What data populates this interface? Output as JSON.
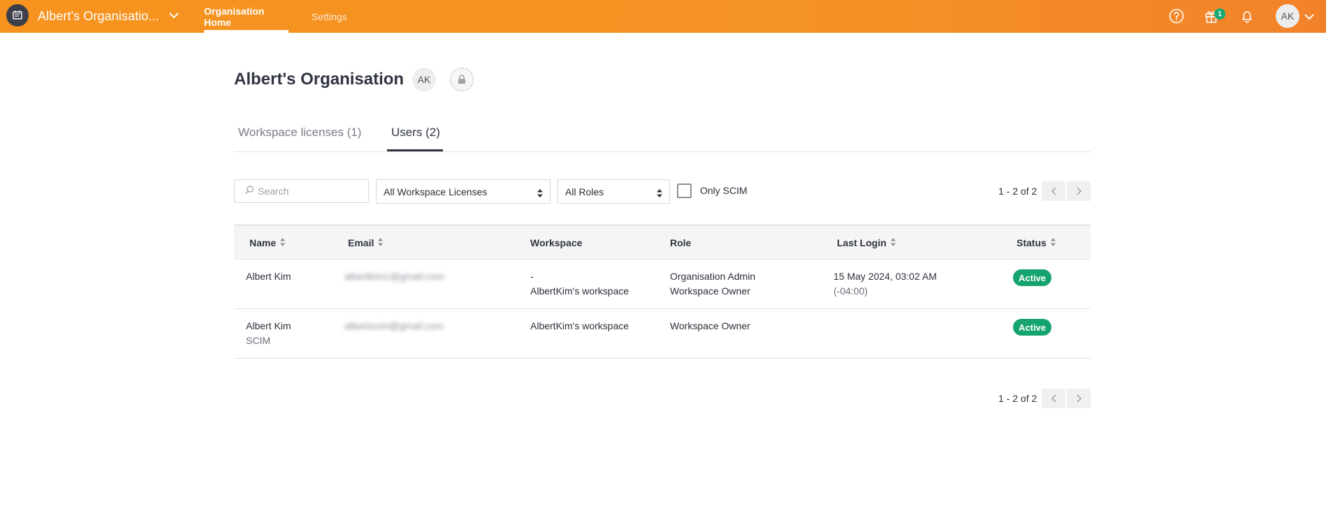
{
  "topbar": {
    "org_name": "Albert's Organisatio...",
    "nav": {
      "home": "Organisation Home",
      "settings": "Settings"
    },
    "gift_badge_count": "1",
    "user_initials": "AK",
    "icons": [
      "app-logo-icon",
      "chevron-down-icon",
      "help-icon",
      "gift-icon",
      "bell-icon"
    ]
  },
  "page": {
    "title": "Albert's Organisation",
    "org_initials": "AK"
  },
  "tabs": {
    "licenses": "Workspace licenses (1)",
    "users": "Users (2)"
  },
  "filters": {
    "search_placeholder": "Search",
    "licenses_selected": "All Workspace Licenses",
    "roles_selected": "All Roles",
    "scim_label": "Only SCIM",
    "scim_checked": false
  },
  "pager": {
    "top": "1 - 2 of 2",
    "bottom": "1 - 2 of 2"
  },
  "table": {
    "headers": {
      "name": "Name",
      "email": "Email",
      "workspace": "Workspace",
      "role": "Role",
      "last_login": "Last Login",
      "status": "Status"
    },
    "rows": [
      {
        "name": "Albert Kim",
        "name_sub": "",
        "email": "albertkim1@gmail.com",
        "workspace_line1": "-",
        "workspace_line2": "AlbertKim's workspace",
        "role_line1": "Organisation Admin",
        "role_line2": "Workspace Owner",
        "last_login": "15 May 2024, 03:02 AM",
        "last_login_tz": "(-04:00)",
        "status": "Active"
      },
      {
        "name": "Albert Kim",
        "name_sub": "SCIM",
        "email": "albertscim@gmail.com",
        "workspace_line1": "AlbertKim's workspace",
        "workspace_line2": "",
        "role_line1": "Workspace Owner",
        "role_line2": "",
        "last_login": "",
        "last_login_tz": "",
        "status": "Active"
      }
    ]
  },
  "colors": {
    "topbar": "#f59224",
    "status_active": "#15a46f",
    "badge": "#19a974"
  }
}
